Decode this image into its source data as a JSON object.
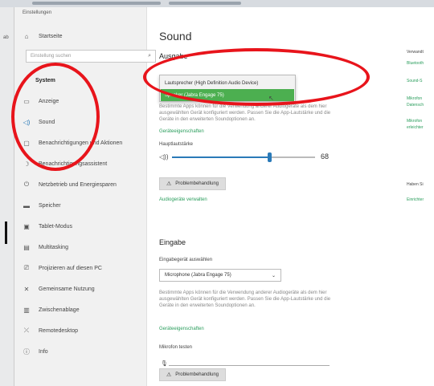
{
  "window": {
    "title": "Einstellungen"
  },
  "sidebar": {
    "home": {
      "label": "Startseite",
      "icon": "home-icon"
    },
    "search_placeholder": "Einstellung suchen",
    "section_header": "System",
    "items": [
      {
        "label": "Anzeige",
        "icon": "display-icon"
      },
      {
        "label": "Sound",
        "icon": "speaker-icon",
        "active": true
      },
      {
        "label": "Benachrichtigungen und Aktionen",
        "icon": "notifications-icon"
      },
      {
        "label": "Benachrichtigungsassistent",
        "icon": "focus-assist-icon"
      },
      {
        "label": "Netzbetrieb und Energiesparen",
        "icon": "power-icon"
      },
      {
        "label": "Speicher",
        "icon": "storage-icon"
      },
      {
        "label": "Tablet-Modus",
        "icon": "tablet-icon"
      },
      {
        "label": "Multitasking",
        "icon": "multitasking-icon"
      },
      {
        "label": "Projizieren auf diesen PC",
        "icon": "projecting-icon"
      },
      {
        "label": "Gemeinsame Nutzung",
        "icon": "shared-experiences-icon"
      },
      {
        "label": "Zwischenablage",
        "icon": "clipboard-icon"
      },
      {
        "label": "Remotedesktop",
        "icon": "remote-desktop-icon"
      },
      {
        "label": "Info",
        "icon": "info-icon"
      }
    ]
  },
  "main": {
    "title": "Sound",
    "output": {
      "heading": "Ausgabe",
      "options": [
        "Lautsprecher (High Definition Audio Device)",
        "Speaker (Jabra Engage 75)"
      ],
      "selected_option": "Speaker (Jabra Engage 75)",
      "description": "Bestimmte Apps können für die Verwendung anderer Audiogeräte als dem hier ausgewählten Gerät konfiguriert werden. Passen Sie die App-Lautstärke und die Geräte in den erweiterten Soundoptionen an.",
      "device_properties_link": "Geräteeigenschaften",
      "master_volume_label": "Hauptlautstärke",
      "volume_value": "68",
      "volume_percent": 68,
      "troubleshoot_button": "Problembehandlung",
      "manage_devices_link": "Audiogeräte verwalten"
    },
    "input": {
      "heading": "Eingabe",
      "select_label": "Eingabegerät auswählen",
      "selected_device": "Microphone (Jabra Engage 75)",
      "description": "Bestimmte Apps können für die Verwendung anderer Audiogeräte als dem hier ausgewählten Gerät konfiguriert werden. Passen Sie die App-Lautstärke und die Geräte in den erweiterten Soundoptionen an.",
      "device_properties_link": "Geräteeigenschaften",
      "test_mic_label": "Mikrofon testen",
      "troubleshoot_button": "Problembehandlung"
    }
  },
  "related": {
    "heading": "Verwandt",
    "links": [
      "Bluetooth",
      "Sound-S",
      "Mikrofon",
      "Datensch",
      "Mikrofon",
      "erleichter"
    ],
    "question": "Haben Si",
    "help_link": "Einrichter"
  },
  "colors": {
    "accent": "#2a7ab8",
    "link": "#2a9d5c",
    "selected_option_bg": "#4caf50",
    "annotation_circle": "#e8141b"
  }
}
